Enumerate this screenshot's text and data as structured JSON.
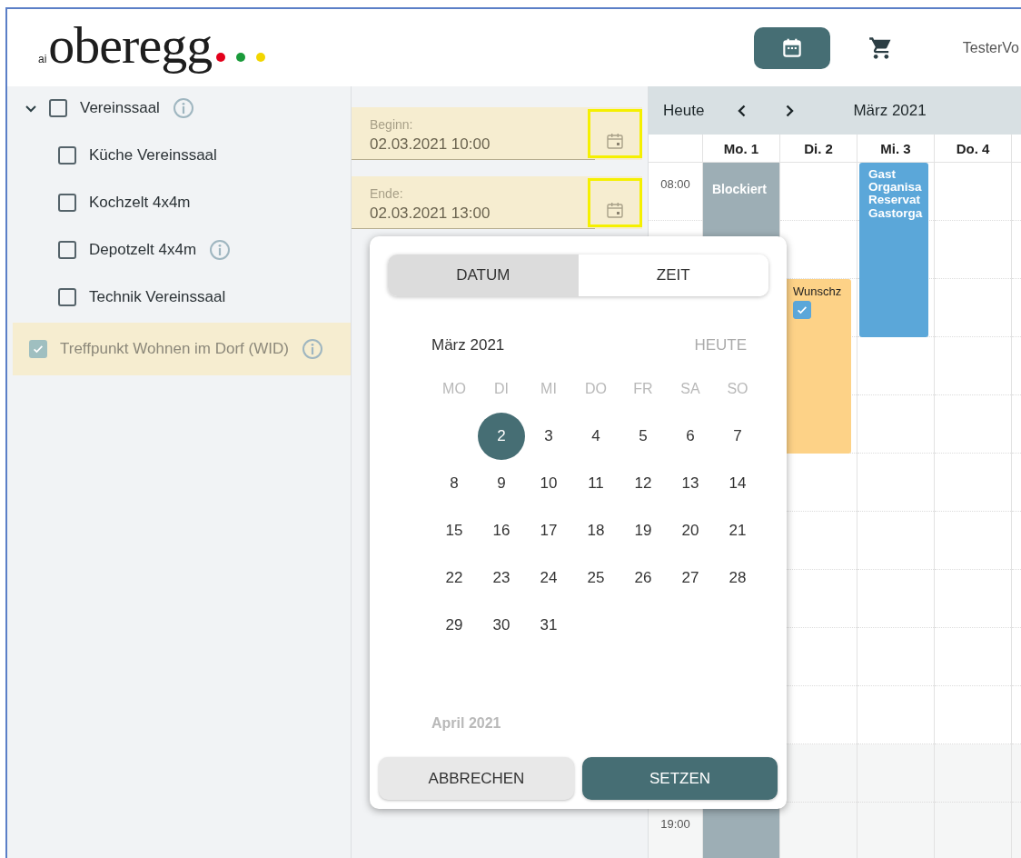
{
  "header": {
    "logo": {
      "prefix": "ai",
      "name": "oberegg",
      "dots": [
        {
          "color": "#e3001b"
        },
        {
          "color": "#1a9a3a"
        },
        {
          "color": "#f2d600"
        }
      ]
    },
    "nav": [
      {
        "kind": "calendar",
        "selected": true
      },
      {
        "kind": "cart",
        "selected": false
      }
    ],
    "user": "TesterVo"
  },
  "sidebar": {
    "items": [
      {
        "label": "Vereinssaal",
        "checked": false,
        "info": true,
        "expanded": true,
        "selected": false,
        "disabled": false,
        "children": [
          {
            "label": "Küche Vereinssaal",
            "checked": false,
            "info": false,
            "selected": false,
            "disabled": false
          },
          {
            "label": "Kochzelt 4x4m",
            "checked": false,
            "info": false,
            "selected": false,
            "disabled": false
          },
          {
            "label": "Depotzelt 4x4m",
            "checked": false,
            "info": true,
            "selected": false,
            "disabled": false
          },
          {
            "label": "Technik Vereinssaal",
            "checked": false,
            "info": false,
            "selected": false,
            "disabled": false
          }
        ]
      },
      {
        "label": "Treffpunkt Wohnen im Dorf (WID)",
        "checked": true,
        "info": true,
        "selected": true,
        "disabled": true
      }
    ]
  },
  "booking": {
    "fields": [
      {
        "label": "Beginn:",
        "value": "02.03.2021 10:00",
        "highlighted": true
      },
      {
        "label": "Ende:",
        "value": "02.03.2021 13:00",
        "highlighted": true
      }
    ]
  },
  "calendar": {
    "today_button": "Heute",
    "month": "März 2021",
    "days": [
      "Mo. 1",
      "Di. 2",
      "Mi. 3",
      "Do. 4"
    ],
    "times": [
      "08:00",
      "19:00"
    ],
    "events": [
      {
        "kind": "blocked",
        "lines": [
          "Blockiert"
        ]
      },
      {
        "kind": "request",
        "lines": [
          "Wunschz"
        ],
        "checked": true
      },
      {
        "kind": "booking",
        "lines": [
          "Gast",
          "Organisa",
          "Reservat",
          "Gastorga"
        ]
      }
    ]
  },
  "date_picker": {
    "tabs": [
      {
        "label": "DATUM",
        "selected": true
      },
      {
        "label": "ZEIT",
        "selected": false
      }
    ],
    "month": "März 2021",
    "today": "HEUTE",
    "weekdays": [
      "MO",
      "DI",
      "MI",
      "DO",
      "FR",
      "SA",
      "SO"
    ],
    "weeks": [
      [
        {
          "label": "2",
          "selected": true
        },
        {
          "label": "3",
          "selected": false
        },
        {
          "label": "4",
          "selected": false
        },
        {
          "label": "5",
          "selected": false
        },
        {
          "label": "6",
          "selected": false
        },
        {
          "label": "7",
          "selected": false
        }
      ],
      [
        {
          "label": "8",
          "selected": false
        },
        {
          "label": "9",
          "selected": false
        },
        {
          "label": "10",
          "selected": false
        },
        {
          "label": "11",
          "selected": false
        },
        {
          "label": "12",
          "selected": false
        },
        {
          "label": "13",
          "selected": false
        },
        {
          "label": "14",
          "selected": false
        }
      ],
      [
        {
          "label": "15",
          "selected": false
        },
        {
          "label": "16",
          "selected": false
        },
        {
          "label": "17",
          "selected": false
        },
        {
          "label": "18",
          "selected": false
        },
        {
          "label": "19",
          "selected": false
        },
        {
          "label": "20",
          "selected": false
        },
        {
          "label": "21",
          "selected": false
        }
      ],
      [
        {
          "label": "22",
          "selected": false
        },
        {
          "label": "23",
          "selected": false
        },
        {
          "label": "24",
          "selected": false
        },
        {
          "label": "25",
          "selected": false
        },
        {
          "label": "26",
          "selected": false
        },
        {
          "label": "27",
          "selected": false
        },
        {
          "label": "28",
          "selected": false
        }
      ],
      [
        {
          "label": "29",
          "selected": false
        },
        {
          "label": "30",
          "selected": false
        },
        {
          "label": "31",
          "selected": false
        }
      ]
    ],
    "next_month": "April 2021",
    "buttons": [
      {
        "label": "ABBRECHEN",
        "kind": "secondary"
      },
      {
        "label": "SETZEN",
        "kind": "primary"
      }
    ]
  }
}
